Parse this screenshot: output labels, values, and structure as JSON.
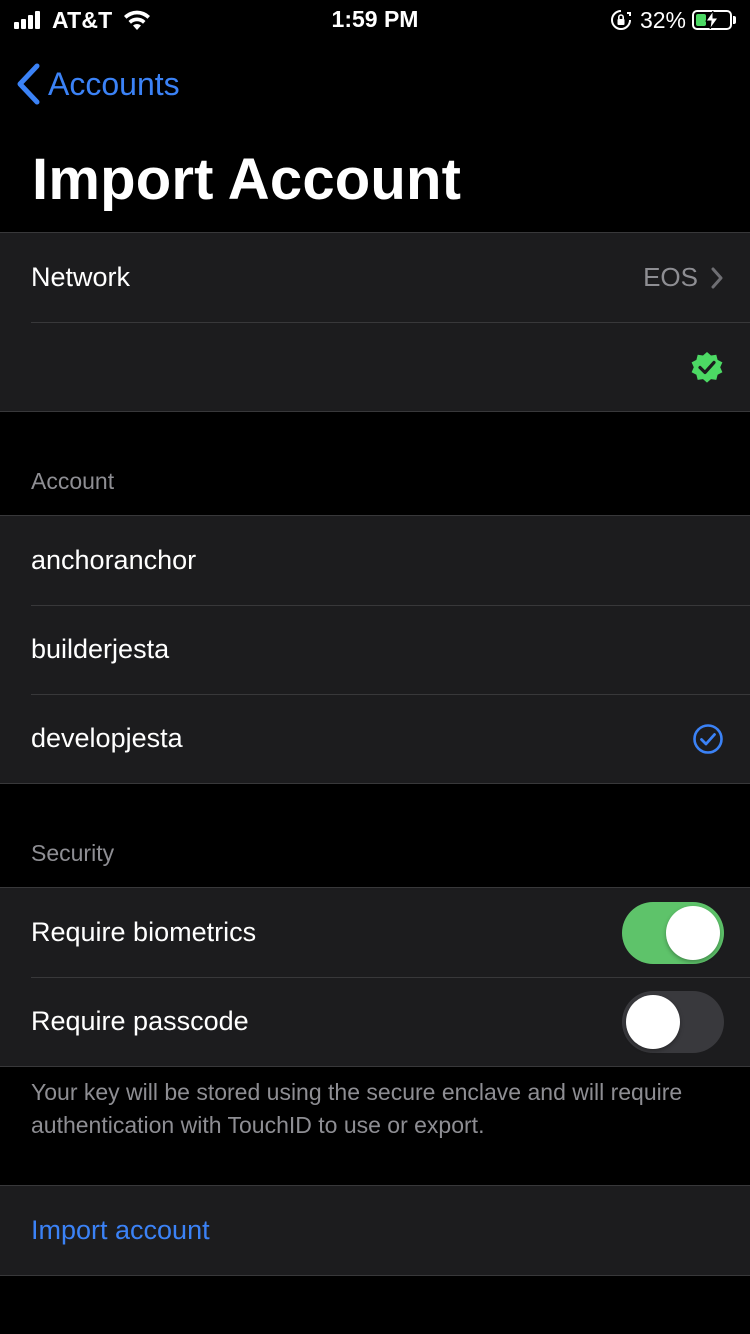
{
  "status_bar": {
    "carrier": "AT&T",
    "time": "1:59 PM",
    "battery_percent": "32%",
    "battery_level": 0.32,
    "icons": [
      "signal-icon",
      "wifi-icon",
      "orientation-lock-icon",
      "battery-charging-icon"
    ]
  },
  "nav": {
    "back_label": "Accounts",
    "title": "Import Account"
  },
  "network_section": {
    "network_label": "Network",
    "network_value": "EOS",
    "verified_icon": "verified-badge-icon"
  },
  "account_section": {
    "header": "Account",
    "accounts": [
      {
        "name": "anchoranchor",
        "selected": false
      },
      {
        "name": "builderjesta",
        "selected": false
      },
      {
        "name": "developjesta",
        "selected": true
      }
    ]
  },
  "security_section": {
    "header": "Security",
    "require_biometrics_label": "Require biometrics",
    "require_biometrics_on": true,
    "require_passcode_label": "Require passcode",
    "require_passcode_on": false,
    "footer": "Your key will be stored using the secure enclave and will require authentication with TouchID to use or export."
  },
  "actions": {
    "import_label": "Import account"
  },
  "colors": {
    "accent": "#3b82f6",
    "toggle_on": "#5ec36a",
    "verified": "#4cd964",
    "background": "#000000",
    "cell": "#1c1c1e"
  }
}
